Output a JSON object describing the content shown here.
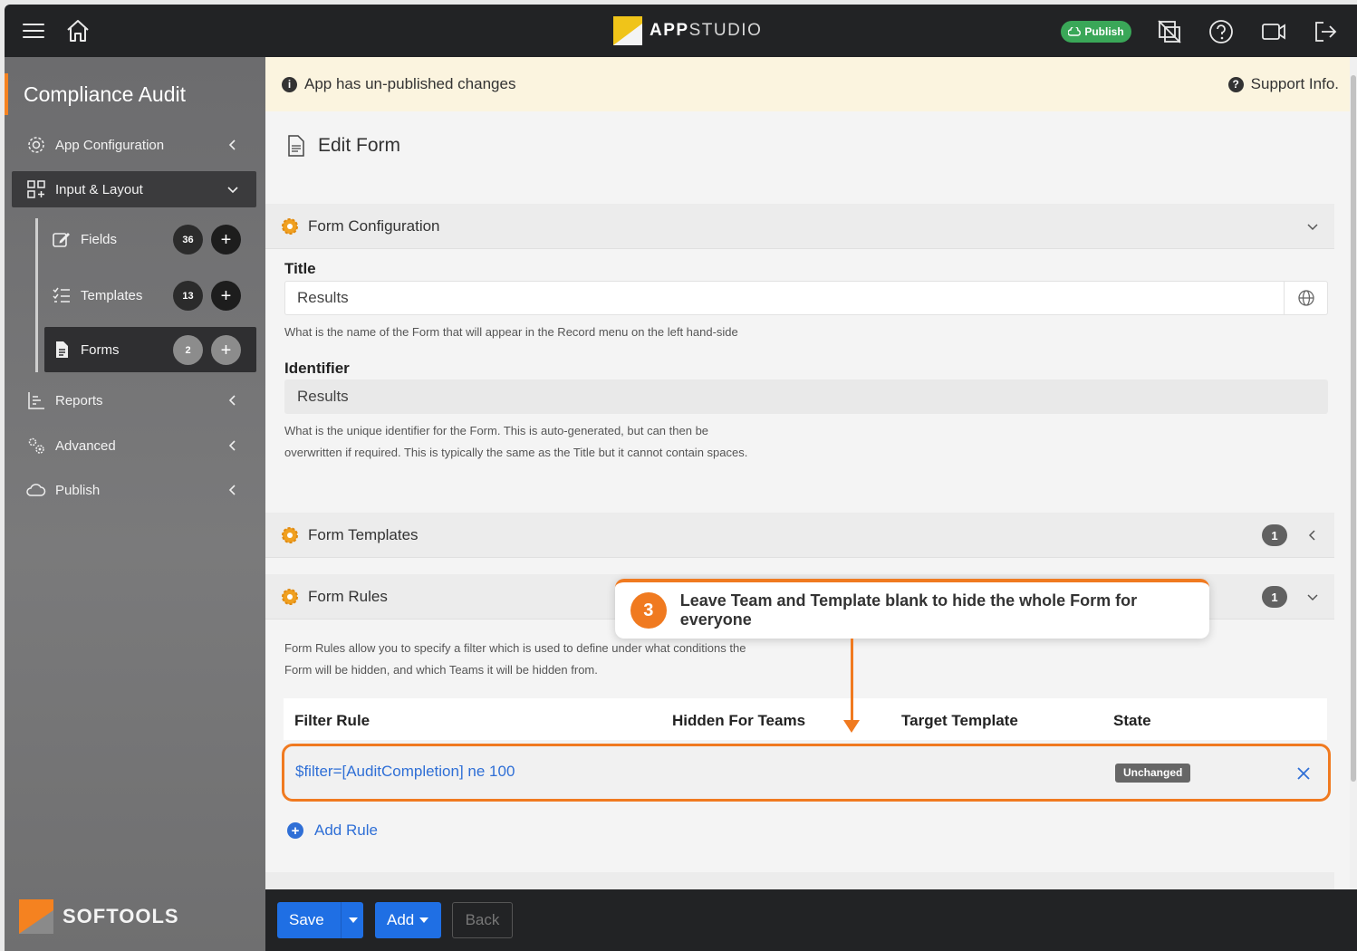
{
  "topbar": {
    "brand_bold": "APP",
    "brand_light": "STUDIO",
    "publish_label": "Publish"
  },
  "sidebar": {
    "title": "Compliance Audit",
    "items": [
      {
        "label": "App Configuration"
      },
      {
        "label": "Input & Layout"
      },
      {
        "label": "Reports"
      },
      {
        "label": "Advanced"
      },
      {
        "label": "Publish"
      }
    ],
    "sub_items": [
      {
        "label": "Fields",
        "count": "36"
      },
      {
        "label": "Templates",
        "count": "13"
      },
      {
        "label": "Forms",
        "count": "2"
      }
    ],
    "footer_logo": "SOFTOOLS"
  },
  "notice": {
    "message": "App has un-published changes",
    "support": "Support Info."
  },
  "page_title": "Edit Form",
  "form_configuration": {
    "heading": "Form Configuration",
    "title_label": "Title",
    "title_value": "Results",
    "title_help": "What is the name of the Form that will appear in the Record menu on the left hand-side",
    "identifier_label": "Identifier",
    "identifier_value": "Results",
    "identifier_help_1": "What is the unique identifier for the Form. This is auto-generated, but can then be",
    "identifier_help_2": "overwritten if required. This is typically the same as the Title but it cannot contain spaces."
  },
  "form_templates": {
    "heading": "Form Templates",
    "count": "1"
  },
  "form_rules": {
    "heading": "Form Rules",
    "count": "1",
    "help_1": "Form Rules allow you to specify a filter which is used to define under what conditions the",
    "help_2": "Form will be hidden, and which Teams it will be hidden from.",
    "columns": [
      "Filter Rule",
      "Hidden For Teams",
      "Target Template",
      "State"
    ],
    "rows": [
      {
        "filter": "$filter=[AuditCompletion] ne 100",
        "teams": "",
        "template": "",
        "state": "Unchanged"
      }
    ],
    "add_rule": "Add Rule"
  },
  "callout": {
    "step": "3",
    "text": "Leave Team and Template blank to hide the whole Form for everyone"
  },
  "footer": {
    "save": "Save",
    "add": "Add",
    "back": "Back"
  },
  "colors": {
    "accent_orange": "#f07a20",
    "link_blue": "#2f6fd6",
    "button_blue": "#1f6fe4",
    "publish_green": "#3aa758"
  }
}
